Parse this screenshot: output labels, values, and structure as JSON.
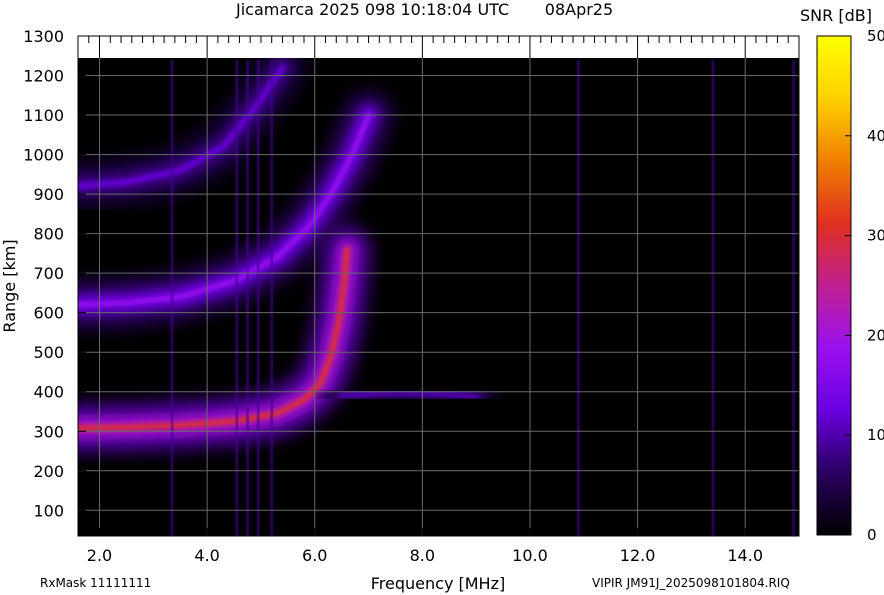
{
  "header": {
    "title": "Jicamarca 2025 098 10:18:04 UTC       08Apr25"
  },
  "footer": {
    "rxmask": "RxMask 11111111",
    "filename": "VIPIR  JM91J_2025098101804.RIQ"
  },
  "chart_data": {
    "type": "heatmap",
    "title": "Jicamarca 2025 098 10:18:04 UTC       08Apr25",
    "xlabel": "Frequency [MHz]",
    "ylabel": "Range [km]",
    "xlim": [
      1.6,
      15.0
    ],
    "ylim": [
      35,
      1300
    ],
    "x_ticks": [
      "2.0",
      "4.0",
      "6.0",
      "8.0",
      "10.0",
      "12.0",
      "14.0"
    ],
    "x_tick_values": [
      2,
      4,
      6,
      8,
      10,
      12,
      14
    ],
    "y_ticks": [
      "100",
      "200",
      "300",
      "400",
      "500",
      "600",
      "700",
      "800",
      "900",
      "1000",
      "1100",
      "1200",
      "1300"
    ],
    "y_tick_values": [
      100,
      200,
      300,
      400,
      500,
      600,
      700,
      800,
      900,
      1000,
      1100,
      1200,
      1300
    ],
    "grid": true,
    "colorbar": {
      "label": "SNR [dB]",
      "range": [
        0,
        50
      ],
      "ticks": [
        "0",
        "10",
        "20",
        "30",
        "40",
        "50"
      ],
      "tick_values": [
        0,
        10,
        20,
        30,
        40,
        50
      ],
      "colors": [
        "#000000",
        "#2a0060",
        "#6a00e0",
        "#9a10f0",
        "#c02090",
        "#e03020",
        "#f08000",
        "#ffd000",
        "#ffff00"
      ]
    },
    "traces": [
      {
        "name": "",
        "points": [
          [
            1.6,
            308
          ],
          [
            2.5,
            310
          ],
          [
            3.5,
            315
          ],
          [
            4.5,
            325
          ],
          [
            5.3,
            345
          ],
          [
            5.8,
            380
          ],
          [
            6.1,
            420
          ],
          [
            6.3,
            490
          ],
          [
            6.45,
            580
          ],
          [
            6.55,
            680
          ],
          [
            6.6,
            760
          ]
        ],
        "snr_db": 30
      },
      {
        "name": "",
        "points": [
          [
            1.6,
            620
          ],
          [
            2.5,
            625
          ],
          [
            3.5,
            640
          ],
          [
            4.5,
            680
          ],
          [
            5.3,
            740
          ],
          [
            5.9,
            820
          ],
          [
            6.3,
            900
          ],
          [
            6.7,
            1000
          ],
          [
            7.0,
            1100
          ]
        ],
        "snr_db": 18
      },
      {
        "name": "",
        "points": [
          [
            1.6,
            920
          ],
          [
            2.5,
            930
          ],
          [
            3.5,
            960
          ],
          [
            4.3,
            1020
          ],
          [
            4.9,
            1120
          ],
          [
            5.4,
            1220
          ]
        ],
        "snr_db": 12
      },
      {
        "name": "",
        "points": [
          [
            6.5,
            390
          ],
          [
            7.5,
            400
          ],
          [
            8.5,
            395
          ],
          [
            9.0,
            385
          ]
        ],
        "snr_db": 10
      }
    ],
    "vertical_interference_lines_mhz": [
      3.35,
      4.55,
      4.75,
      4.95,
      5.2,
      10.9,
      13.4,
      14.9
    ]
  }
}
